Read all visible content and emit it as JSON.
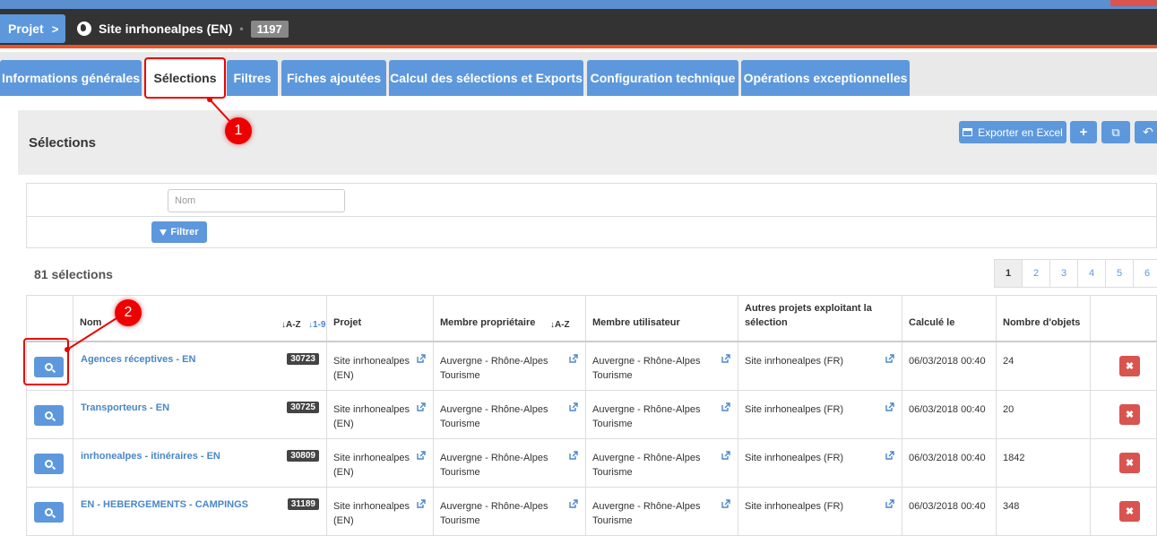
{
  "header": {
    "projet_label": "Projet",
    "chevron": ">",
    "site_name": "Site inrhonealpes (EN)",
    "separator": "•",
    "project_id": "1197"
  },
  "tabs": [
    {
      "label": "Informations générales"
    },
    {
      "label": "Sélections"
    },
    {
      "label": "Filtres"
    },
    {
      "label": "Fiches ajoutées"
    },
    {
      "label": "Calcul des sélections et Exports"
    },
    {
      "label": "Configuration technique"
    },
    {
      "label": "Opérations exceptionnelles"
    }
  ],
  "annotations": {
    "first": "1",
    "second": "2"
  },
  "panel": {
    "title": "Sélections",
    "export_label": "Exporter en Excel",
    "add_label": "+",
    "copy_label": "⧉",
    "back_label": "↶"
  },
  "filter": {
    "nom_placeholder": "Nom",
    "filtrer_label": "Filtrer"
  },
  "count_label": "81 sélections",
  "pagination": [
    "1",
    "2",
    "3",
    "4",
    "5",
    "6"
  ],
  "table": {
    "headers": {
      "nom": "Nom",
      "projet": "Projet",
      "membre_proprietaire": "Membre propriétaire",
      "membre_utilisateur": "Membre utilisateur",
      "autres_projets": "Autres projets exploitant la sélection",
      "calcule_le": "Calculé le",
      "nombre_objets": "Nombre d'objets"
    },
    "sort_icons": {
      "az": "↓A-Z",
      "num": "↓1-9",
      "az2": "↓A-Z"
    },
    "delete_label": "✖",
    "rows": [
      {
        "nom": "Agences réceptives - EN",
        "id": "30723",
        "projet": "Site inrhonealpes (EN)",
        "proprietaire": "Auvergne - Rhône-Alpes Tourisme",
        "utilisateur": "Auvergne - Rhône-Alpes Tourisme",
        "autres": "Site inrhonealpes (FR)",
        "calcule": "06/03/2018 00:40",
        "nombre": "24"
      },
      {
        "nom": "Transporteurs - EN",
        "id": "30725",
        "projet": "Site inrhonealpes (EN)",
        "proprietaire": "Auvergne - Rhône-Alpes Tourisme",
        "utilisateur": "Auvergne - Rhône-Alpes Tourisme",
        "autres": "Site inrhonealpes (FR)",
        "calcule": "06/03/2018 00:40",
        "nombre": "20"
      },
      {
        "nom": "inrhonealpes - itinéraires - EN",
        "id": "30809",
        "projet": "Site inrhonealpes (EN)",
        "proprietaire": "Auvergne - Rhône-Alpes Tourisme",
        "utilisateur": "Auvergne - Rhône-Alpes Tourisme",
        "autres": "Site inrhonealpes (FR)",
        "calcule": "06/03/2018 00:40",
        "nombre": "1842"
      },
      {
        "nom": "EN - HEBERGEMENTS - CAMPINGS",
        "id": "31189",
        "projet": "Site inrhonealpes (EN)",
        "proprietaire": "Auvergne - Rhône-Alpes Tourisme",
        "utilisateur": "Auvergne - Rhône-Alpes Tourisme",
        "autres": "Site inrhonealpes (FR)",
        "calcule": "06/03/2018 00:40",
        "nombre": "348"
      }
    ]
  },
  "colors": {
    "accent": "#5d98dd",
    "header": "#333333",
    "orange": "#e8542c",
    "danger": "#d9534f",
    "annotation": "#ee0000"
  }
}
